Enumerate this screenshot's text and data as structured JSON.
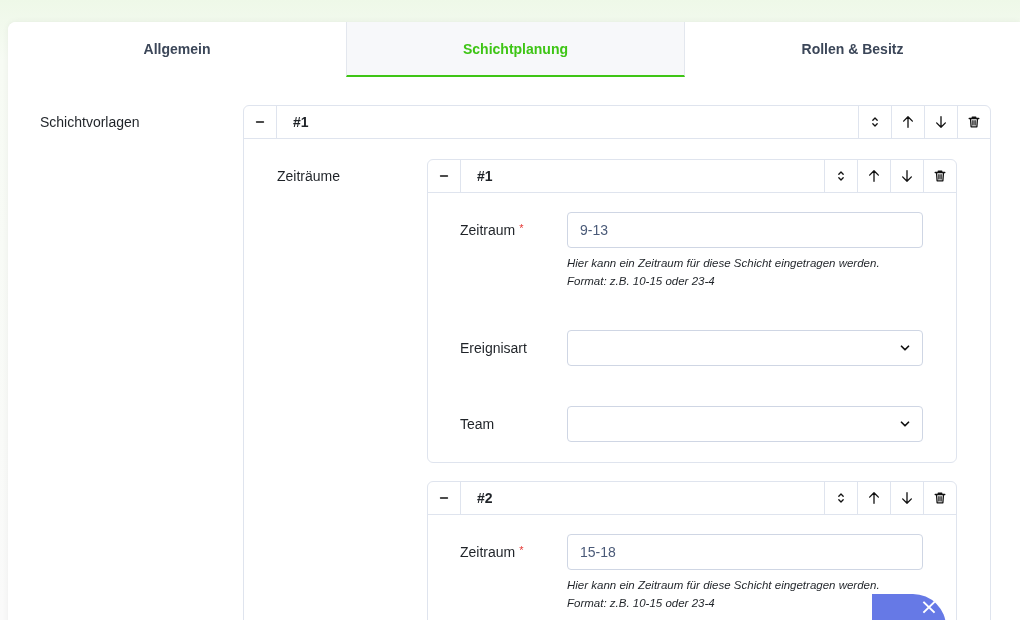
{
  "tabs": [
    {
      "label": "Allgemein",
      "selected": false
    },
    {
      "label": "Schichtplanung",
      "selected": true
    },
    {
      "label": "Rollen & Besitz",
      "selected": false
    }
  ],
  "section": {
    "label": "Schichtvorlagen",
    "templates": [
      {
        "title": "#1",
        "periods_label": "Zeiträume",
        "periods": [
          {
            "title": "#1",
            "fields": [
              {
                "kind": "text",
                "label": "Zeitraum",
                "required_mark": "*",
                "value": "9-13",
                "help_lines": [
                  "Hier kann ein Zeitraum für diese Schicht eingetragen werden.",
                  "Format: z.B. 10-15 oder 23-4"
                ]
              },
              {
                "kind": "select",
                "label": "Ereignisart"
              },
              {
                "kind": "select",
                "label": "Team"
              }
            ]
          },
          {
            "title": "#2",
            "fields": [
              {
                "kind": "text",
                "label": "Zeitraum",
                "required_mark": "*",
                "value": "15-18",
                "help_lines": [
                  "Hier kann ein Zeitraum für diese Schicht eingetragen werden.",
                  "Format: z.B. 10-15 oder 23-4"
                ]
              }
            ]
          }
        ]
      }
    ]
  },
  "fab": {
    "label": "×"
  }
}
